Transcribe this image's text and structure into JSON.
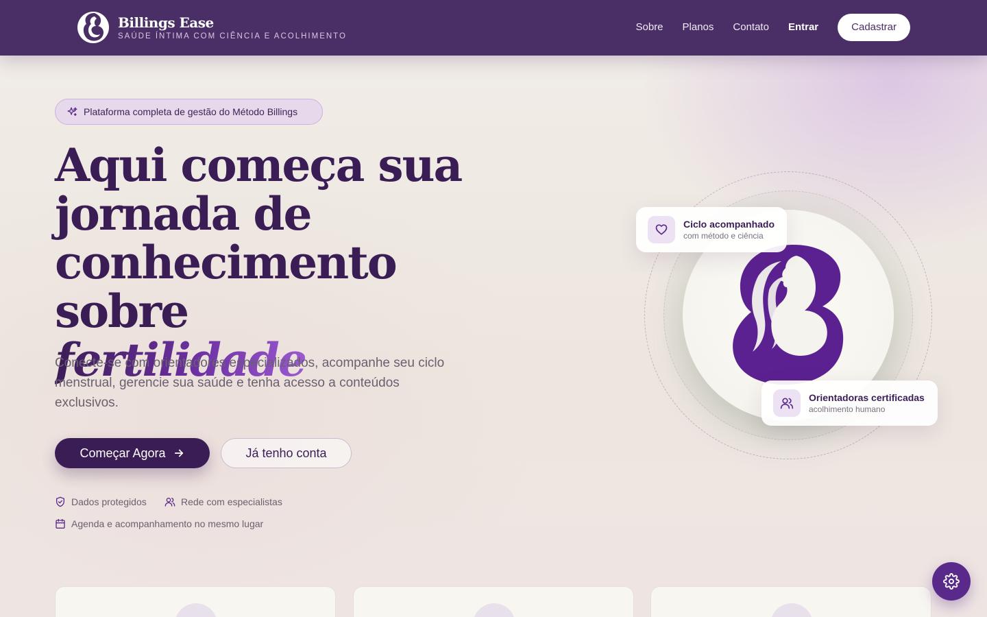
{
  "brand": {
    "name": "Billings Ease",
    "tagline": "SAÚDE ÍNTIMA COM CIÊNCIA E ACOLHIMENTO"
  },
  "nav": {
    "about": "Sobre",
    "plans": "Planos",
    "contact": "Contato",
    "login": "Entrar",
    "signup": "Cadastrar"
  },
  "hero": {
    "badge": "Plataforma completa de gestão do Método Billings",
    "title_line1": "Aqui começa sua",
    "title_line2": "jornada de",
    "title_line3": "conhecimento sobre",
    "title_accent": "fertilidade",
    "subtitle": "Conecte-se com orientadores especializados, acompanhe seu ciclo menstrual, gerencie sua saúde e tenha acesso a conteúdos exclusivos.",
    "cta_primary": "Começar Agora",
    "cta_secondary": "Já tenho conta"
  },
  "features": {
    "data_protected": "Dados protegidos",
    "specialists": "Rede com especialistas",
    "agenda": "Agenda e acompanhamento no mesmo lugar"
  },
  "cards": {
    "cycle_title": "Ciclo acompanhado",
    "cycle_sub": "com método e ciência",
    "advisors_title": "Orientadoras certificadas",
    "advisors_sub": "acolhimento humano"
  },
  "icons": {
    "badge": "sparkles-icon",
    "cta_arrow": "arrow-right-icon",
    "data_protected": "shield-check-icon",
    "specialists": "users-icon",
    "agenda": "calendar-icon",
    "cycle_card": "heart-icon",
    "advisors_card": "users-icon",
    "settings": "gear-icon"
  },
  "colors": {
    "header_bg": "#4a2e66",
    "primary": "#3b1d55",
    "accent": "#6b2fa0",
    "fab": "#5a2a8a"
  }
}
